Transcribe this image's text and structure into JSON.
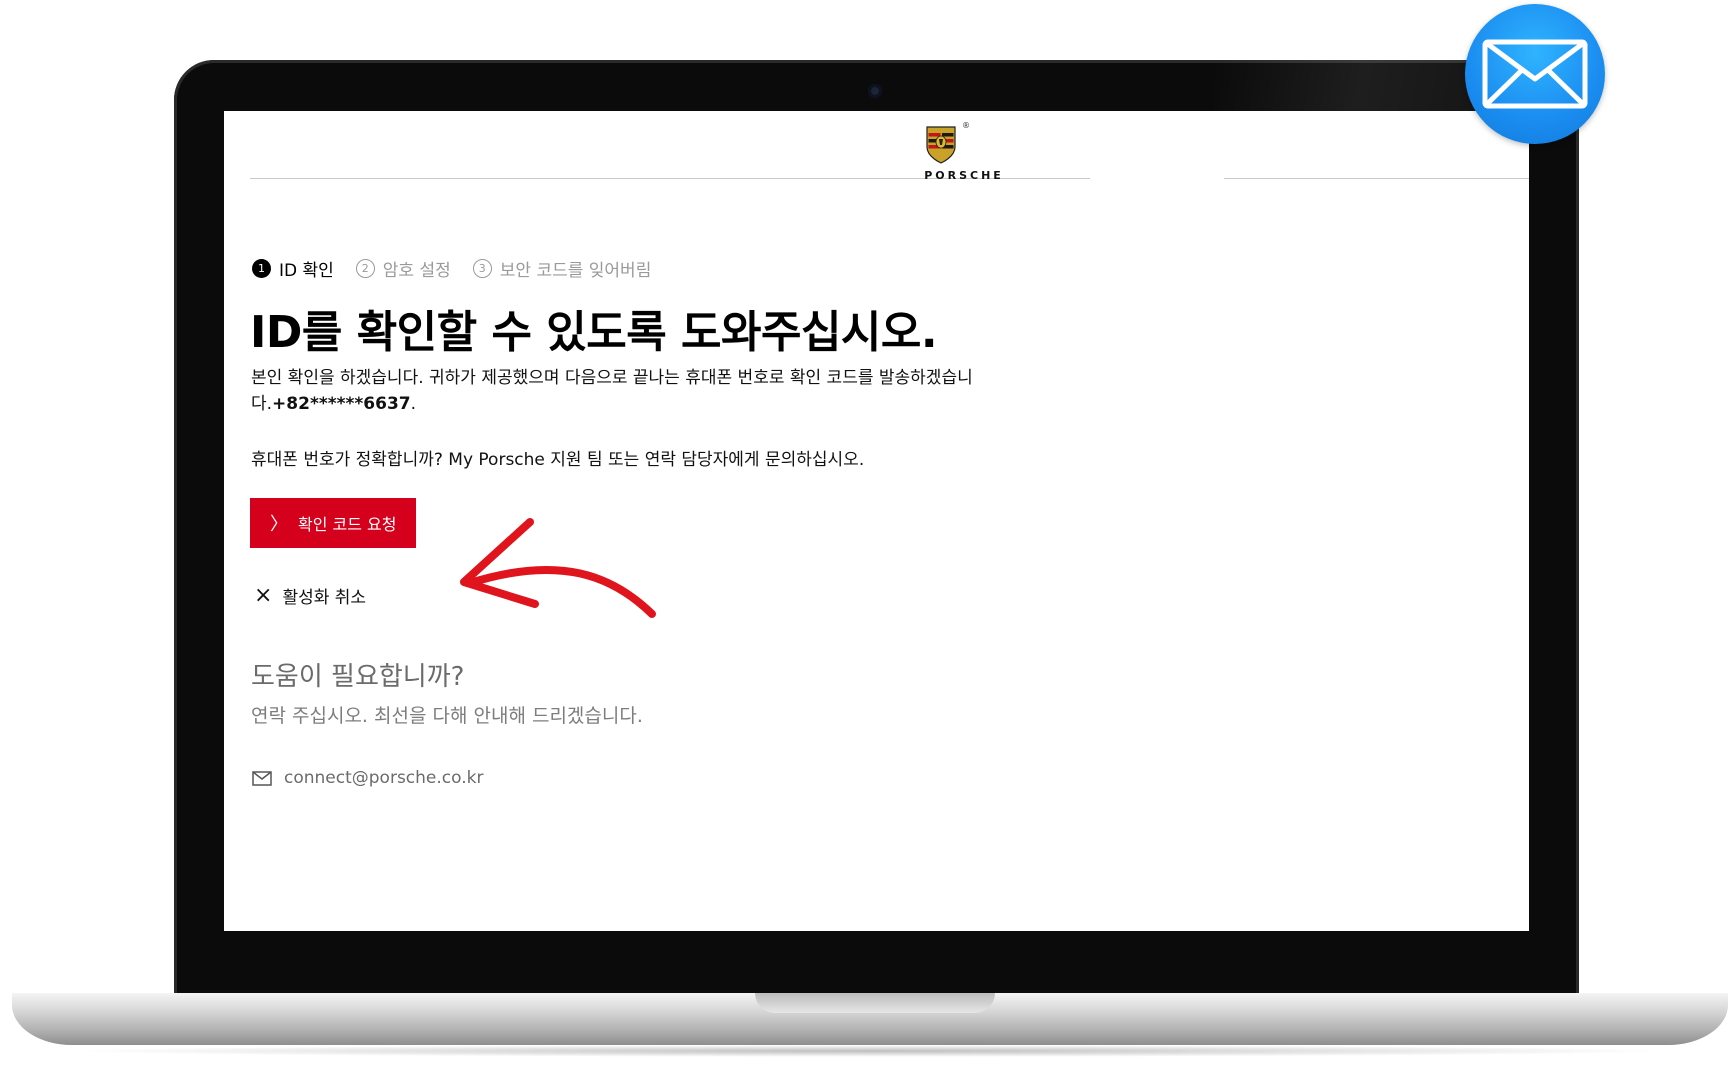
{
  "brand": {
    "wordmark": "PORSCHE",
    "registered": "®"
  },
  "stepper": [
    {
      "number": "1",
      "label": "ID 확인",
      "active": true
    },
    {
      "number": "2",
      "label": "암호 설정",
      "active": false
    },
    {
      "number": "3",
      "label": "보안 코드를 잊어버림",
      "active": false
    }
  ],
  "main": {
    "title": "ID를 확인할 수 있도록 도와주십시오.",
    "body_prefix": "본인 확인을 하겠습니다. 귀하가 제공했으며 다음으로 끝나는 휴대폰 번호로 확인 코드를 발송하겠습니다.",
    "phone": "+82******6637",
    "body_suffix": ".",
    "question": "휴대폰 번호가 정확합니까? My Porsche 지원 팀 또는 연락 담당자에게 문의하십시오.",
    "request_button": "확인 코드 요청",
    "cancel_link": "활성화 취소"
  },
  "help": {
    "title": "도움이 필요합니까?",
    "subtitle": "연락 주십시오. 최선을 다해 안내해 드리겠습니다.",
    "email": "connect@porsche.co.kr"
  },
  "colors": {
    "primary": "#d5001c",
    "mail_badge": "#1a8cf0"
  },
  "icons": [
    "porsche-crest-icon",
    "chevron-right-icon",
    "close-icon",
    "envelope-icon",
    "mail-app-icon",
    "annotation-arrow"
  ]
}
